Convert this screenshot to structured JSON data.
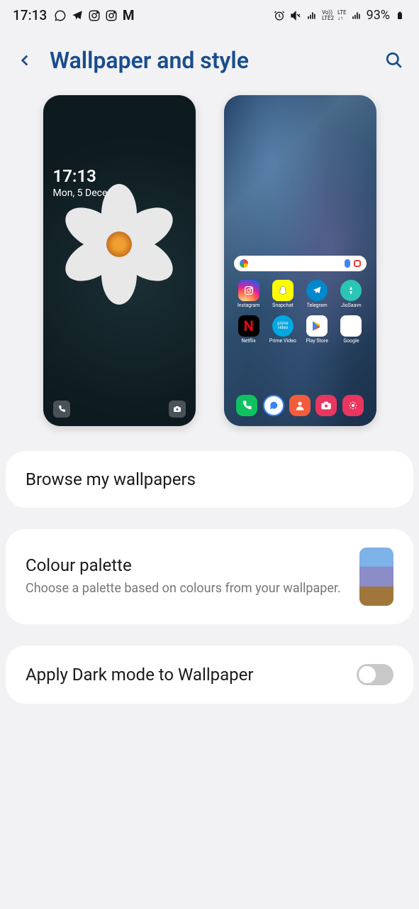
{
  "status": {
    "time": "17:13",
    "battery": "93%"
  },
  "header": {
    "title": "Wallpaper and style"
  },
  "lockscreen": {
    "time": "17:13",
    "date": "Mon, 5 December"
  },
  "homescreen": {
    "apps": [
      {
        "label": "Instagram"
      },
      {
        "label": "Snapchat"
      },
      {
        "label": "Telegram"
      },
      {
        "label": "JioSaavn"
      },
      {
        "label": "Netflix"
      },
      {
        "label": "Prime Video"
      },
      {
        "label": "Play Store"
      },
      {
        "label": "Google"
      }
    ]
  },
  "cards": {
    "browse": {
      "title": "Browse my wallpapers"
    },
    "palette": {
      "title": "Colour palette",
      "subtitle": "Choose a palette based on colours from your wallpaper.",
      "colors": [
        "#7db3e8",
        "#8c8cc8",
        "#a0763a"
      ]
    },
    "darkmode": {
      "title": "Apply Dark mode to Wallpaper",
      "enabled": false
    }
  }
}
